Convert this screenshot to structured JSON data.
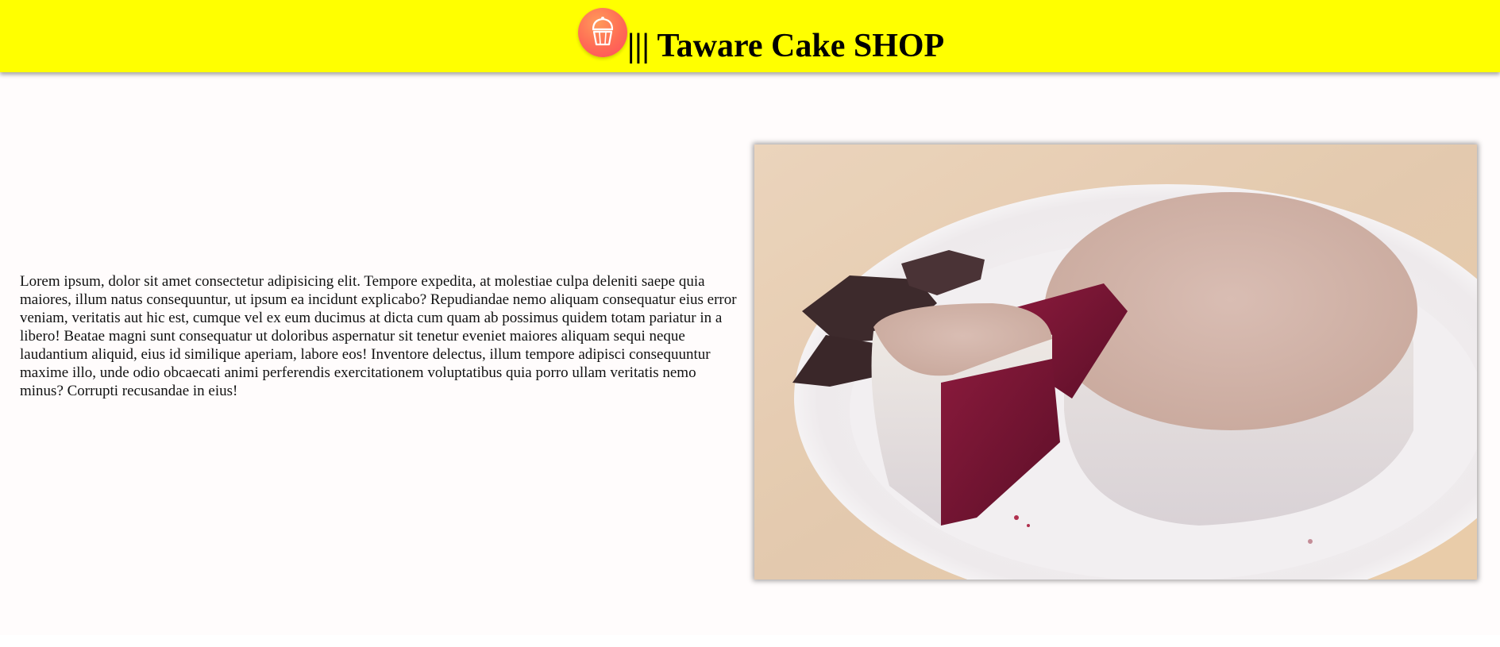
{
  "header": {
    "logo_icon": "cupcake-icon",
    "title": "||| Taware Cake SHOP",
    "background": "#ffff00",
    "logo_color": "#ff5a5f"
  },
  "content": {
    "paragraph": "Lorem ipsum, dolor sit amet consectetur adipisicing elit. Tempore expedita, at molestiae culpa deleniti saepe quia maiores, illum natus consequuntur, ut ipsum ea incidunt explicabo? Repudiandae nemo aliquam consequatur eius error veniam, veritatis aut hic est, cumque vel ex eum ducimus at dicta cum quam ab possimus quidem totam pariatur in a libero! Beatae magni sunt consequatur ut doloribus aspernatur sit tenetur eveniet maiores aliquam sequi neque laudantium aliquid, eius id similique aperiam, labore eos! Inventore delectus, illum tempore adipisci consequuntur maxime illo, unde odio obcaecati animi perferendis exercitationem voluptatibus quia porro ullam veritatis nemo minus? Corrupti recusandae in eius!",
    "image_subject": "red-velvet-cake-photo"
  }
}
